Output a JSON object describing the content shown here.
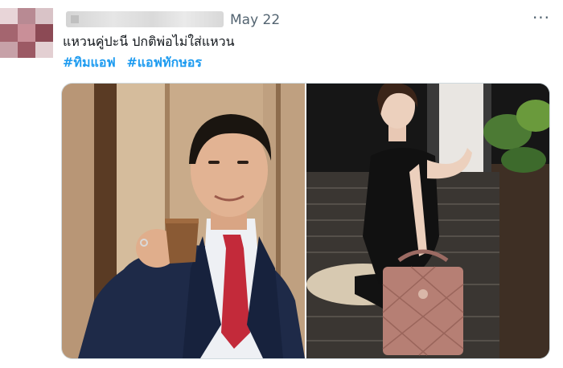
{
  "tweet": {
    "date": "May 22",
    "more_icon": "more-horizontal-icon",
    "text": "แหวนคู่ปะนี ปกติพ่อไม่ใส่แหวน",
    "hashtags": [
      "#ทิมแอฟ",
      "#แอฟทักษอร"
    ]
  },
  "media": {
    "left_photo": "man-in-navy-suit-holding-cup",
    "right_photo": "woman-in-black-dress-with-pink-handbag"
  },
  "colors": {
    "link": "#1d9bf0",
    "muted": "#536471",
    "text": "#0f1419"
  }
}
